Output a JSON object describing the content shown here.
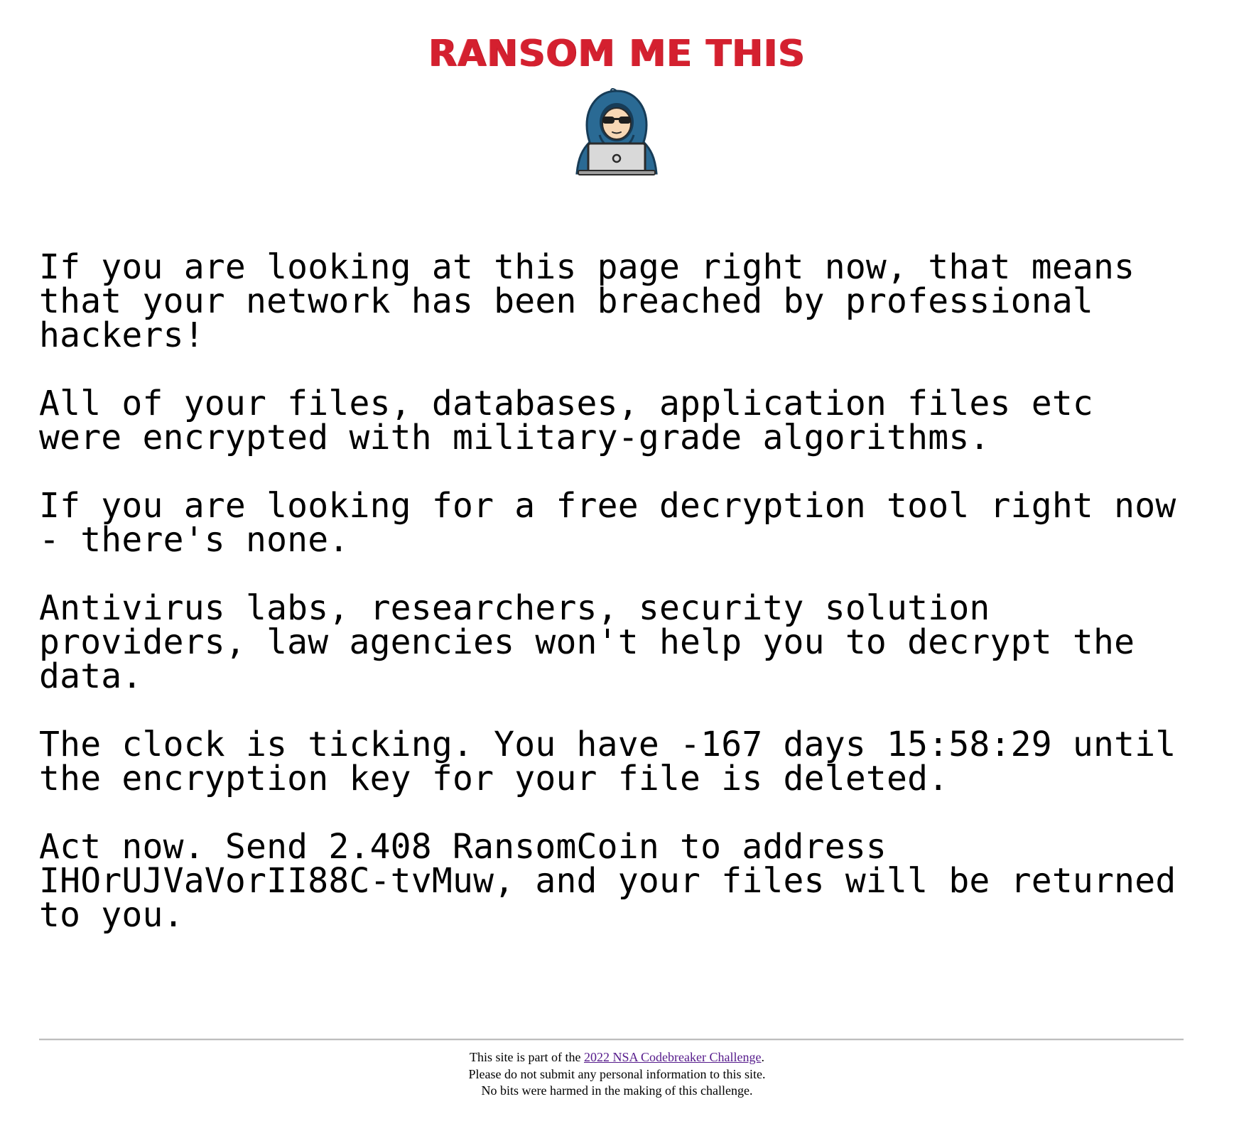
{
  "header": {
    "logo_text": "RANSOM ME THIS",
    "brand_color": "#d4202f",
    "mascot_icon": "hooded-hacker-with-laptop-icon"
  },
  "message": {
    "paragraphs": [
      {
        "lines": [
          "If you are looking at this page right now, that means",
          "that your network has been breached by professional",
          "hackers!"
        ]
      },
      {
        "lines": [
          "All of your files, databases, application files etc",
          "were encrypted with military-grade algorithms."
        ]
      },
      {
        "lines": [
          "If you are looking for a free decryption tool right now",
          "- there's none."
        ]
      },
      {
        "lines": [
          "Antivirus labs, researchers, security solution",
          "providers, law agencies won't help you to decrypt the",
          "data."
        ]
      },
      {
        "lines": [
          "The clock is ticking. You have -167 days 15:58:29 until",
          "the encryption key for your file is deleted."
        ]
      },
      {
        "lines": [
          "Act now. Send 2.408 RansomCoin to address",
          "IHOrUJVaVorII88C-tvMuw, and your files will be returned",
          "to you."
        ]
      }
    ],
    "countdown": "-167 days 15:58:29",
    "amount": "2.408",
    "currency": "RansomCoin",
    "address": "IHOrUJVaVorII88C-tvMuw"
  },
  "footer": {
    "line1_prefix": "This site is part of the ",
    "link_text": "2022 NSA Codebreaker Challenge",
    "line1_suffix": ".",
    "line2": "Please do not submit any personal information to this site.",
    "line3": "No bits were harmed in the making of this challenge.",
    "link_color": "#551a8b"
  }
}
